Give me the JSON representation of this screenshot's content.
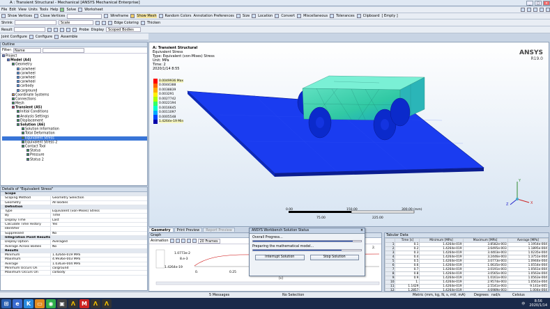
{
  "window": {
    "title": "A : Transient Structural - Mechanical [ANSYS Mechanical Enterprise]",
    "controls": [
      "_",
      "□",
      "×"
    ]
  },
  "menu": [
    "File",
    "Edit",
    "View",
    "Units",
    "Tools",
    "Help"
  ],
  "toolbar1": {
    "solve": "Solve",
    "worksheet": "Worksheet",
    "show_vertices": "Show Vertices",
    "close_vertices": "Close Vertices",
    "wireframe": "Wireframe",
    "show_mesh": "Show Mesh",
    "random_colors": "Random Colors",
    "annotation_prefs": "Annotation Preferences",
    "size": "Size",
    "location": "Location",
    "convert": "Convert",
    "miscellaneous": "Miscellaneous",
    "tolerances": "Tolerances",
    "clipboard": "Clipboard",
    "empty": "[ Empty ]"
  },
  "toolbar2": {
    "shrink_label": "Shrink",
    "scale": "Scale",
    "edge_coloring": "Edge Coloring",
    "thicken": "Thicken"
  },
  "toolbar3": {
    "result_label": "Result",
    "probe": "Probe",
    "display": "Display",
    "scoped_bodies": "Scoped Bodies"
  },
  "toolbar4": {
    "joint_configure": "Joint Configure",
    "configure": "Configure",
    "assemble": "Assemble"
  },
  "outline": {
    "header": "Outline",
    "filter_label": "Filter:",
    "filter_value": "Name",
    "items": [
      {
        "label": "Project",
        "indent": 0,
        "color": "#6a8ab8"
      },
      {
        "label": "Model (A4)",
        "indent": 1,
        "color": "#4a7ac8",
        "bold": true
      },
      {
        "label": "Geometry",
        "indent": 2,
        "color": "#3ca03c"
      },
      {
        "label": "carwheel",
        "indent": 3,
        "color": "#4fa3d0"
      },
      {
        "label": "carwheel",
        "indent": 3,
        "color": "#4fa3d0"
      },
      {
        "label": "carwheel",
        "indent": 3,
        "color": "#4fa3d0"
      },
      {
        "label": "carwheel",
        "indent": 3,
        "color": "#4fa3d0"
      },
      {
        "label": "carbody",
        "indent": 3,
        "color": "#4fa3d0"
      },
      {
        "label": "carground",
        "indent": 3,
        "color": "#4fa3d0"
      },
      {
        "label": "Coordinate Systems",
        "indent": 2,
        "color": "#c8a040"
      },
      {
        "label": "Connections",
        "indent": 2,
        "color": "#3ca03c"
      },
      {
        "label": "Mesh",
        "indent": 2,
        "color": "#3ca03c"
      },
      {
        "label": "Transient (A5)",
        "indent": 2,
        "color": "#c84040",
        "bold": true
      },
      {
        "label": "Initial Conditions",
        "indent": 3,
        "color": "#3ca03c"
      },
      {
        "label": "Analysis Settings",
        "indent": 3,
        "color": "#3ca03c"
      },
      {
        "label": "Displacement",
        "indent": 3,
        "color": "#3ca03c"
      },
      {
        "label": "Solution (A6)",
        "indent": 3,
        "color": "#3ca03c",
        "bold": true
      },
      {
        "label": "Solution Information",
        "indent": 4,
        "color": "#3ca03c"
      },
      {
        "label": "Total Deformation",
        "indent": 4,
        "color": "#3ca03c"
      },
      {
        "label": "Equivalent Stress",
        "indent": 4,
        "color": "#3ca03c",
        "selected": true
      },
      {
        "label": "Equivalent Stress 2",
        "indent": 4,
        "color": "#3ca03c"
      },
      {
        "label": "Contact Tool",
        "indent": 4,
        "color": "#3ca03c"
      },
      {
        "label": "Status",
        "indent": 5,
        "color": "#3ca03c"
      },
      {
        "label": "Pressure",
        "indent": 5,
        "color": "#3ca03c"
      },
      {
        "label": "Status 2",
        "indent": 5,
        "color": "#3ca03c"
      }
    ]
  },
  "details": {
    "header": "Details of \"Equivalent Stress\"",
    "rows": [
      {
        "k": "Scope",
        "v": "",
        "sec": true
      },
      {
        "k": "Scoping Method",
        "v": "Geometry Selection"
      },
      {
        "k": "Geometry",
        "v": "All Bodies"
      },
      {
        "k": "Definition",
        "v": "",
        "sec": true
      },
      {
        "k": "Type",
        "v": "Equivalent (von-Mises) Stress"
      },
      {
        "k": "By",
        "v": "Time"
      },
      {
        "k": "Display Time",
        "v": "Last"
      },
      {
        "k": "Calculate Time History",
        "v": "Yes"
      },
      {
        "k": "Identifier",
        "v": ""
      },
      {
        "k": "Suppressed",
        "v": "No"
      },
      {
        "k": "Integration Point Results",
        "v": "",
        "sec": true
      },
      {
        "k": "Display Option",
        "v": "Averaged"
      },
      {
        "k": "Average Across Bodies",
        "v": "No"
      },
      {
        "k": "Results",
        "v": "",
        "sec": true
      },
      {
        "k": "Minimum",
        "v": "1.4264e-019 MPa"
      },
      {
        "k": "Maximum",
        "v": "4.9936e-003 MPa"
      },
      {
        "k": "Average",
        "v": "1.0363e-004 MPa"
      },
      {
        "k": "Minimum Occurs On",
        "v": "carground"
      },
      {
        "k": "Maximum Occurs On",
        "v": "carbody"
      }
    ]
  },
  "viewport": {
    "result_title": "A: Transient Structural",
    "result_lines": [
      "Equivalent Stress",
      "Type: Equivalent (von-Mises) Stress",
      "Unit: MPa",
      "Time: 2",
      "2020/1/14 8:55"
    ],
    "brand": "ANSYS",
    "version": "R19.0",
    "legend": {
      "max": "0.0049936 Max",
      "levels": [
        "0.0044388",
        "0.0038839",
        "0.003291",
        "0.0027742",
        "0.0022194",
        "0.0016645",
        "0.0011097",
        "0.0005548"
      ],
      "min": "1.4264e-19 Min",
      "colors": [
        "#ff0000",
        "#ff6600",
        "#ffaa00",
        "#ffee00",
        "#aaff00",
        "#33ff66",
        "#00ffcc",
        "#00aaff",
        "#0044ff",
        "#0000aa"
      ]
    },
    "scale": {
      "ticks": [
        "0.00",
        "150.00",
        "300.00 (mm)"
      ],
      "subticks": [
        "75.00",
        "225.00"
      ]
    },
    "axes": {
      "x": "X",
      "y": "Y",
      "z": "Z"
    }
  },
  "bottom_tabs": [
    "Geometry",
    "Print Preview",
    "Report Preview"
  ],
  "graph": {
    "header": "Graph",
    "animation_label": "Animation",
    "frames": "20 Frames",
    "y_vals": [
      "1.0773e-2",
      "8.e-3",
      "1.4264e-19"
    ],
    "x_vals": [
      "0.",
      "0.25",
      "0.5"
    ],
    "left_mark": "1.",
    "right_mark": "2.",
    "bracket": "[s]"
  },
  "dialog": {
    "title": "ANSYS Workbench Solution Status",
    "overall": "Overall Progress...",
    "progress_overall": 0.92,
    "prep": "Preparing the mathematical model...",
    "progress_prep": 0.82,
    "interrupt": "Interrupt Solution",
    "stop": "Stop Solution",
    "close": "×"
  },
  "tabular": {
    "header": "Tabular Data",
    "columns": [
      "Time [s]",
      "Minimum [MPa]",
      "Maximum [MPa]",
      "Average [MPa]"
    ],
    "rows": [
      [
        "1",
        "0.1",
        "1.4264e-019",
        "3.8582e-003",
        "1.1954e-004"
      ],
      [
        "2",
        "0.2",
        "1.4264e-019",
        "3.6495e-003",
        "1.1895e-004"
      ],
      [
        "3",
        "0.3",
        "1.4264e-019",
        "3.4403e-003",
        "1.0235e-004"
      ],
      [
        "4",
        "0.4",
        "1.4264e-019",
        "3.2446e-003",
        "1.3751e-004"
      ],
      [
        "5",
        "0.5",
        "1.4264e-019",
        "3.0773e-003",
        "1.0944e-004"
      ],
      [
        "6",
        "0.6",
        "1.4264e-019",
        "1.0635e-003",
        "1.0554e-004"
      ],
      [
        "7",
        "0.7",
        "1.4264e-019",
        "3.0191e-003",
        "1.0561e-004"
      ],
      [
        "8",
        "0.8",
        "1.4264e-019",
        "3.0565e-003",
        "1.0563e-004"
      ],
      [
        "9",
        "0.9",
        "1.4264e-019",
        "1.0161e-003",
        "1.0563e-004"
      ],
      [
        "10",
        "1.",
        "1.4264e-019",
        "2.9574e-003",
        "1.0561e-004"
      ],
      [
        "11",
        "1.1429",
        "1.4264e-019",
        "2.5541e-003",
        "9.141e-005"
      ],
      [
        "12",
        "1.2857",
        "1.4264e-019",
        "4.6989e-003",
        "1.004e-004"
      ]
    ]
  },
  "status": {
    "messages": "5 Messages",
    "selection": "No Selection",
    "units": "Metric (mm, kg, N, s, mV, mA)",
    "degrees": "Degrees",
    "rad": "rad/s",
    "celsius": "Celsius"
  },
  "taskbar": {
    "time": "8:56",
    "date": "2020/1/14",
    "ime": "中"
  }
}
